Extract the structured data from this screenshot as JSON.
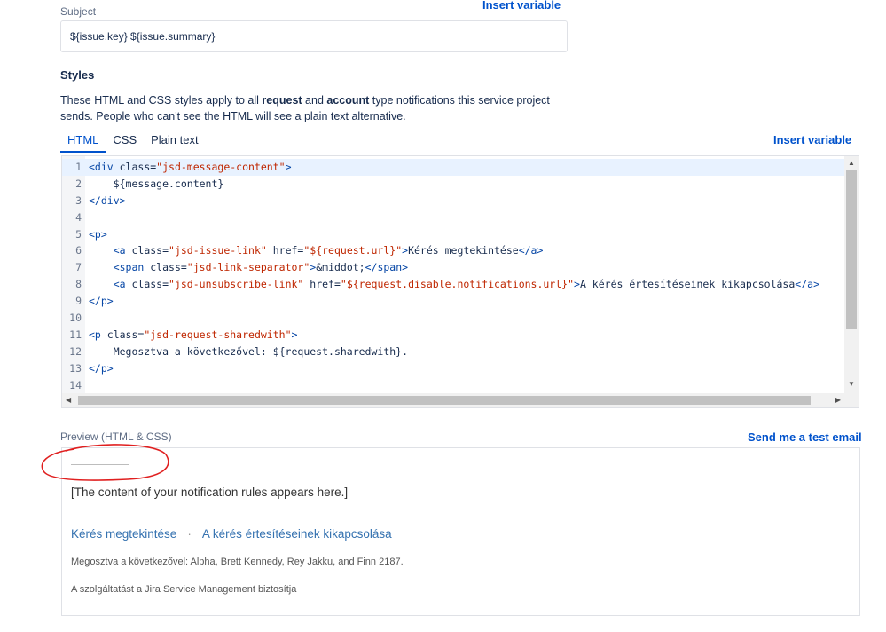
{
  "subject": {
    "label": "Subject",
    "insert_variable": "Insert variable",
    "value": "${issue.key} ${issue.summary}"
  },
  "styles": {
    "title": "Styles",
    "desc_part1": "These HTML and CSS styles apply to all ",
    "desc_bold1": "request",
    "desc_part2": " and ",
    "desc_bold2": "account",
    "desc_part3": " type notifications this service project sends. People who can't see the HTML will see a plain text alternative.",
    "tabs": [
      {
        "label": "HTML",
        "active": true
      },
      {
        "label": "CSS",
        "active": false
      },
      {
        "label": "Plain text",
        "active": false
      }
    ],
    "insert_variable": "Insert variable"
  },
  "editor": {
    "lines": [
      {
        "n": "1",
        "text": "<div class=\"jsd-message-content\">"
      },
      {
        "n": "2",
        "text": "    ${message.content}"
      },
      {
        "n": "3",
        "text": "</div>"
      },
      {
        "n": "4",
        "text": ""
      },
      {
        "n": "5",
        "text": "<p>"
      },
      {
        "n": "6",
        "text": "    <a class=\"jsd-issue-link\" href=\"${request.url}\">Kérés megtekintése</a>"
      },
      {
        "n": "7",
        "text": "    <span class=\"jsd-link-separator\">&middot;</span>"
      },
      {
        "n": "8",
        "text": "    <a class=\"jsd-unsubscribe-link\" href=\"${request.disable.notifications.url}\">A kérés értesítéseinek kikapcsolása</a>"
      },
      {
        "n": "9",
        "text": "</p>"
      },
      {
        "n": "10",
        "text": ""
      },
      {
        "n": "11",
        "text": "<p class=\"jsd-request-sharedwith\">"
      },
      {
        "n": "12",
        "text": "    Megosztva a következővel: ${request.sharedwith}."
      },
      {
        "n": "13",
        "text": "</p>"
      },
      {
        "n": "14",
        "text": ""
      }
    ]
  },
  "preview": {
    "label": "Preview (HTML & CSS)",
    "send_test": "Send me a test email",
    "content": "[The content of your notification rules appears here.]",
    "link_view": "Kérés megtekintése",
    "separator": "·",
    "link_unsubscribe": "A kérés értesítéseinek kikapcsolása",
    "shared_with": "Megosztva a következővel: Alpha, Brett Kennedy, Rey Jakku, and Finn 2187.",
    "powered_by": "A szolgáltatást a Jira Service Management biztosítja"
  },
  "colors": {
    "link": "#0052cc",
    "annotation": "#e02020"
  }
}
